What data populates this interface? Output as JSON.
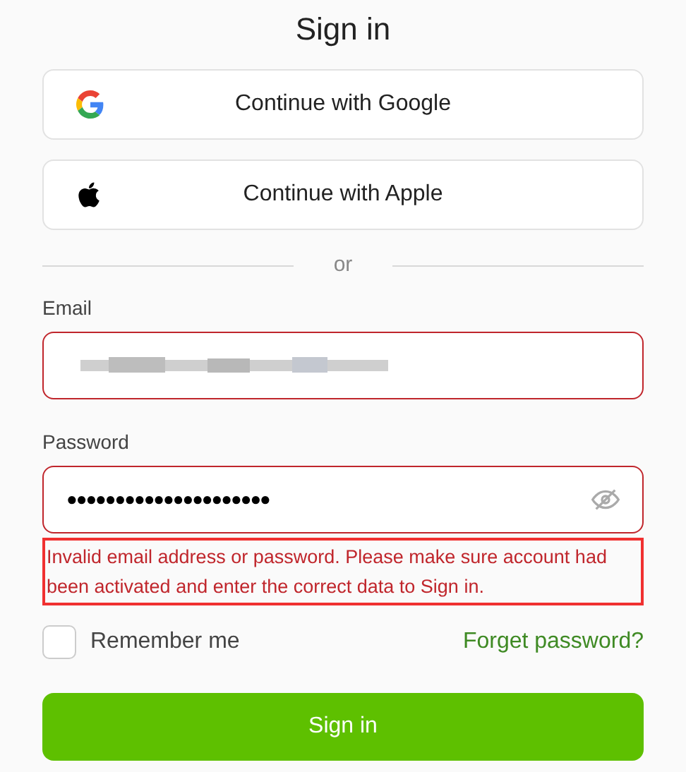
{
  "title": "Sign in",
  "social_buttons": [
    {
      "kind": "google",
      "label": "Continue with Google"
    },
    {
      "kind": "apple",
      "label": "Continue with Apple"
    }
  ],
  "divider": "or",
  "email": {
    "label": "Email",
    "invalid": true
  },
  "password": {
    "label": "Password",
    "value": "●●●●●●●●●●●●●●●●●●●●●",
    "invalid": true,
    "visible": false
  },
  "error": {
    "text": "Invalid email address or password. Please make sure account had been activated and enter the correct data to Sign in.",
    "highlighted": true
  },
  "remember": {
    "label": "Remember me",
    "checked": false
  },
  "forgot_link": "Forget password?",
  "submit": "Sign in"
}
